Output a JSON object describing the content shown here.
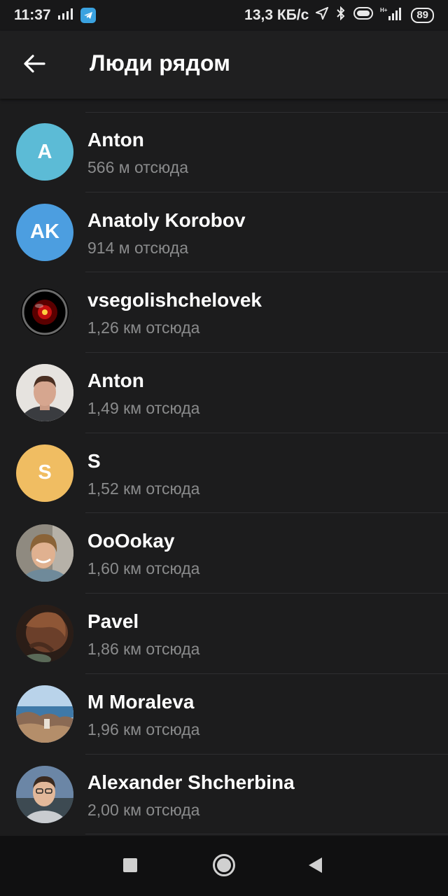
{
  "status_bar": {
    "time": "11:37",
    "network_speed": "13,3 КБ/с",
    "battery": "89",
    "icons": [
      "signal-activity-icon",
      "telegram-icon",
      "location-icon",
      "bluetooth-icon",
      "toggle-icon",
      "hplus-signal-icon",
      "battery-icon"
    ]
  },
  "app_bar": {
    "title": "Люди рядом",
    "back_icon": "arrow-left-icon"
  },
  "people": [
    {
      "name": "Anton",
      "distance": "566 м отсюда",
      "avatar_initials": "A",
      "avatar_color": "#5cbbd6"
    },
    {
      "name": "Anatoly Korobov",
      "distance": "914 м отсюда",
      "avatar_initials": "AK",
      "avatar_color": "#4c9ee0"
    },
    {
      "name": "vsegolishchelovek",
      "distance": "1,26 км отсюда",
      "avatar_initials": "",
      "avatar_color": "#000000"
    },
    {
      "name": "Anton",
      "distance": "1,49 км отсюда",
      "avatar_initials": "",
      "avatar_color": "#e6e3df"
    },
    {
      "name": "S",
      "distance": "1,52 км отсюда",
      "avatar_initials": "S",
      "avatar_color": "#f0bd62"
    },
    {
      "name": "OoOokay",
      "distance": "1,60 км отсюда",
      "avatar_initials": "",
      "avatar_color": "#8a7f74"
    },
    {
      "name": "Pavel",
      "distance": "1,86 км отсюда",
      "avatar_initials": "",
      "avatar_color": "#3b2a22"
    },
    {
      "name": "M Moraleva",
      "distance": "1,96 км отсюда",
      "avatar_initials": "",
      "avatar_color": "#7fa7c8"
    },
    {
      "name": "Alexander Shcherbina",
      "distance": "2,00 км отсюда",
      "avatar_initials": "",
      "avatar_color": "#5a6f86"
    }
  ],
  "nav_bar": {
    "icons": [
      "recents-square-icon",
      "home-circle-icon",
      "back-triangle-icon"
    ]
  }
}
